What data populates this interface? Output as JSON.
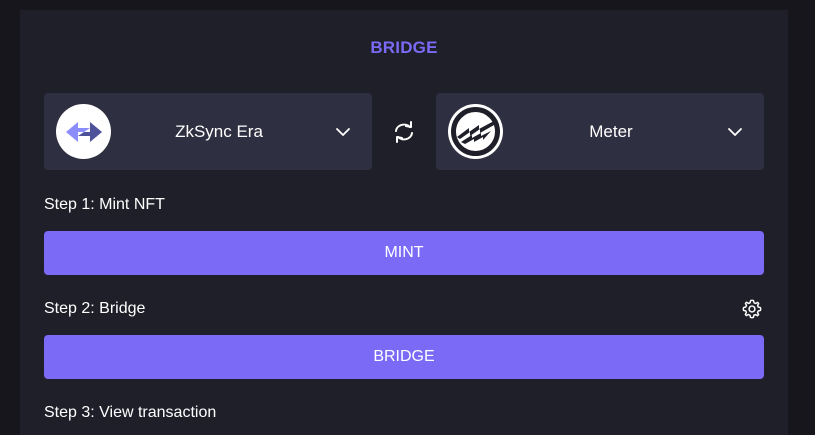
{
  "header": {
    "title": "BRIDGE"
  },
  "from_chain": {
    "name": "ZkSync Era",
    "logo_icon": "zksync-logo-icon"
  },
  "to_chain": {
    "name": "Meter",
    "logo_icon": "meter-logo-icon"
  },
  "steps": [
    {
      "label": "Step 1: Mint NFT",
      "button": "MINT"
    },
    {
      "label": "Step 2: Bridge",
      "button": "BRIDGE"
    },
    {
      "label": "Step 3: View transaction"
    }
  ],
  "colors": {
    "accent": "#7a6af6",
    "panel_bg": "#1f1f29",
    "select_bg": "#2f2f42",
    "page_bg": "#16161c"
  }
}
